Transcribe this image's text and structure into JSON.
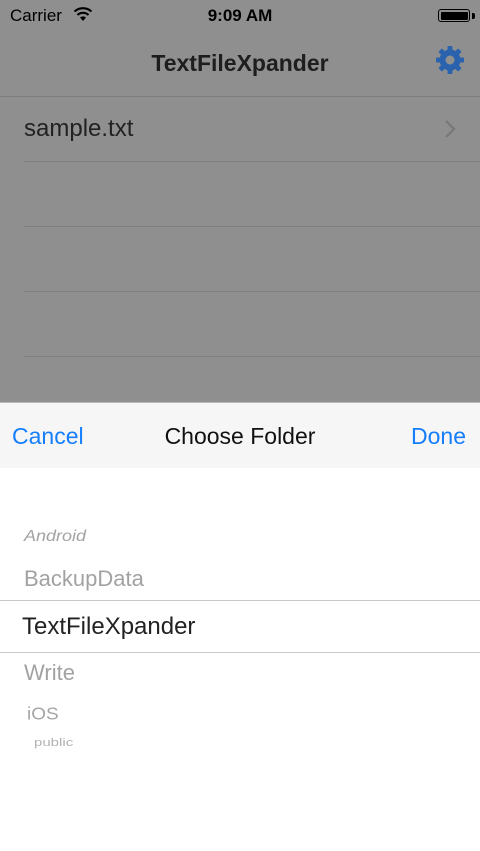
{
  "status_bar": {
    "carrier": "Carrier",
    "time": "9:09 AM"
  },
  "nav": {
    "title": "TextFileXpander",
    "settings_icon": "gear-icon"
  },
  "file_list": {
    "items": [
      "sample.txt"
    ]
  },
  "picker_sheet": {
    "cancel_label": "Cancel",
    "title": "Choose Folder",
    "done_label": "Done",
    "options": [
      "Android",
      "BackupData",
      "TextFileXpander",
      "Write",
      "iOS",
      "public"
    ],
    "selected": "TextFileXpander"
  },
  "colors": {
    "accent": "#157efb",
    "dim_overlay": "#8f8f8f"
  }
}
